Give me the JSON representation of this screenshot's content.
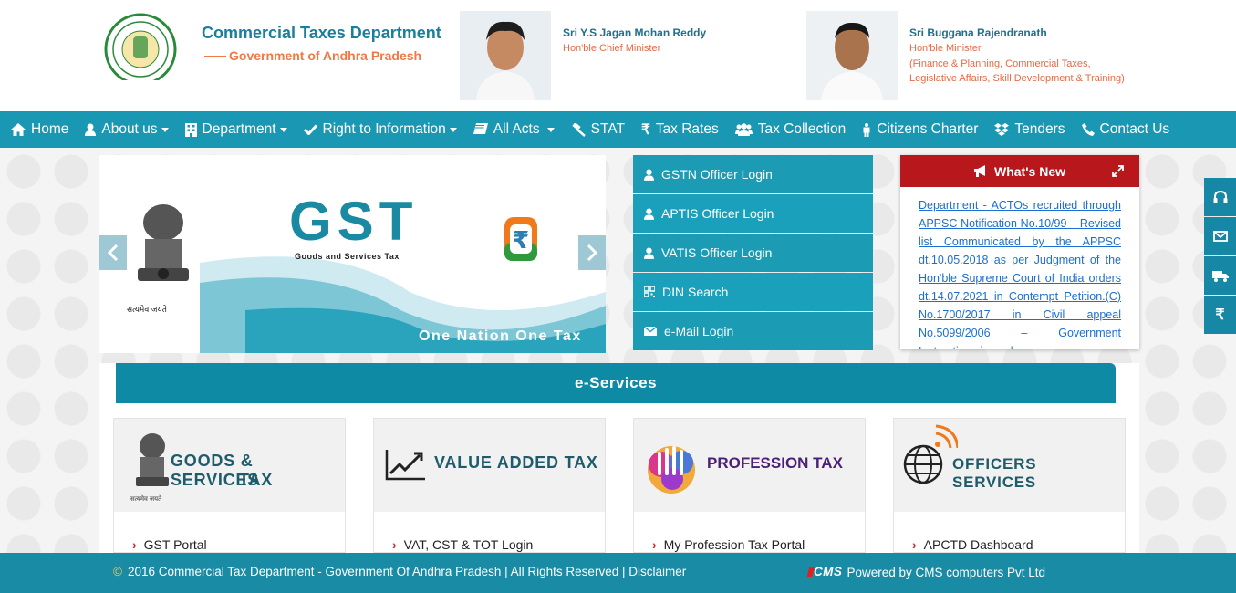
{
  "header": {
    "dept_title": "Commercial Taxes Department",
    "dept_subtitle": "Government of Andhra Pradesh",
    "leader1": {
      "name": "Sri Y.S Jagan Mohan Reddy",
      "role": "Hon'ble Chief Minister"
    },
    "leader2": {
      "name": "Sri Buggana Rajendranath",
      "role": "Hon'ble Minister",
      "portfolio_line1": "(Finance & Planning, Commercial Taxes,",
      "portfolio_line2": "Legislative Affairs, Skill Development & Training)"
    }
  },
  "nav": {
    "items": [
      {
        "label": "Home",
        "icon": "home-icon",
        "dropdown": false
      },
      {
        "label": "About us",
        "icon": "user-icon",
        "dropdown": true
      },
      {
        "label": "Department",
        "icon": "building-icon",
        "dropdown": true
      },
      {
        "label": "Right to Information",
        "icon": "check-icon",
        "dropdown": true
      },
      {
        "label": "All Acts",
        "icon": "book-icon",
        "dropdown": true
      },
      {
        "label": "STAT",
        "icon": "gavel-icon",
        "dropdown": false
      },
      {
        "label": "Tax Rates",
        "icon": "rupee-icon",
        "dropdown": false
      },
      {
        "label": "Tax Collection",
        "icon": "users-icon",
        "dropdown": false
      },
      {
        "label": "Citizens Charter",
        "icon": "person-icon",
        "dropdown": false
      },
      {
        "label": "Tenders",
        "icon": "dropbox-icon",
        "dropdown": false
      },
      {
        "label": "Contact Us",
        "icon": "phone-icon",
        "dropdown": false
      }
    ]
  },
  "slider": {
    "gst_title": "GST",
    "gst_subtitle": "Goods and Services Tax",
    "tagline": "One Nation One Tax",
    "emblem_motto": "सत्यमेव जयते"
  },
  "logins": [
    {
      "label": "GSTN Officer Login",
      "icon": "user-icon"
    },
    {
      "label": "APTIS Officer Login",
      "icon": "user-icon"
    },
    {
      "label": "VATIS Officer Login",
      "icon": "user-icon"
    },
    {
      "label": "DIN Search",
      "icon": "qrcode-icon"
    },
    {
      "label": "e-Mail Login",
      "icon": "envelope-icon"
    }
  ],
  "whats_new": {
    "title": "What's New",
    "text": "Department - ACTOs recruited through APPSC Notification No.10/99 – Revised list Communicated by the APPSC dt.10.05.2018 as per Judgment of the Hon'ble Supreme Court of India orders dt.14.07.2021 in Contempt Petition.(C) No.1700/2017 in Civil appeal No.5099/2006 – Government Instructions issued"
  },
  "side_float": [
    "headset-icon",
    "envelope-icon",
    "truck-icon",
    "rupee-icon"
  ],
  "eservices": {
    "title": "e-Services",
    "cards": [
      {
        "title_line1": "GOODS & SERVICES",
        "title_line2": "TAX",
        "motto": "सत्यमेव जयते",
        "link": "GST Portal"
      },
      {
        "title_line1": "VALUE ADDED TAX",
        "link": "VAT, CST & TOT Login"
      },
      {
        "title_line1": "PROFESSION TAX",
        "link": "My Profession Tax Portal"
      },
      {
        "title_line1": "OFFICERS SERVICES",
        "link": "APCTD Dashboard"
      }
    ]
  },
  "footer": {
    "copyright_symbol": "©",
    "copyright": "2016 Commercial Tax Department - Government Of Andhra Pradesh | All Rights Reserved | Disclaimer",
    "powered_logo_a": "▮",
    "powered_logo_b": "CMS",
    "powered": "Powered by CMS computers Pvt Ltd"
  },
  "colors": {
    "nav": "#1a97b3",
    "accent": "#1a8aa3",
    "whats_new_head": "#b8181c",
    "footer": "#1a8ba5"
  }
}
